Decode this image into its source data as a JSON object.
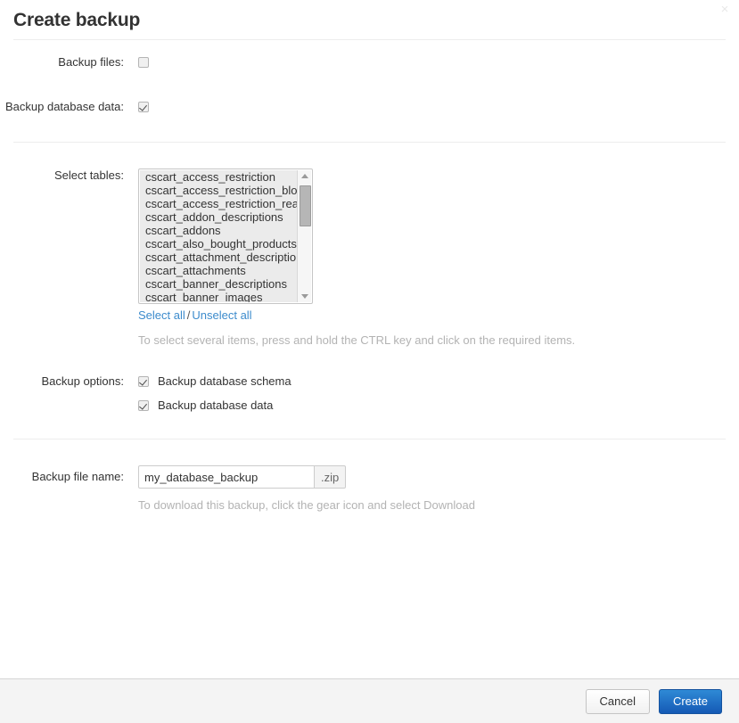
{
  "dialog": {
    "title": "Create backup",
    "close_icon": "×"
  },
  "form": {
    "backup_files": {
      "label": "Backup files:",
      "checked": false
    },
    "backup_database_data": {
      "label": "Backup database data:",
      "checked": true
    },
    "select_tables": {
      "label": "Select tables:",
      "items": [
        "cscart_access_restriction",
        "cscart_access_restriction_block",
        "cscart_access_restriction_reason",
        "cscart_addon_descriptions",
        "cscart_addons",
        "cscart_also_bought_products",
        "cscart_attachment_descriptions",
        "cscart_attachments",
        "cscart_banner_descriptions",
        "cscart_banner_images"
      ],
      "select_all_label": "Select all",
      "separator": "/",
      "unselect_all_label": "Unselect all",
      "hint": "To select several items, press and hold the CTRL key and click on the required items."
    },
    "backup_options": {
      "label": "Backup options:",
      "options": [
        {
          "label": "Backup database schema",
          "checked": true
        },
        {
          "label": "Backup database data",
          "checked": true
        }
      ]
    },
    "backup_file_name": {
      "label": "Backup file name:",
      "value": "my_database_backup",
      "placeholder": "",
      "addon": ".zip",
      "hint": "To download this backup, click the gear icon and select Download"
    }
  },
  "footer": {
    "cancel_label": "Cancel",
    "create_label": "Create"
  },
  "colors": {
    "link": "#3c8bcc",
    "primary_button": "#1559b5",
    "hint_text": "#b3b3b3"
  }
}
